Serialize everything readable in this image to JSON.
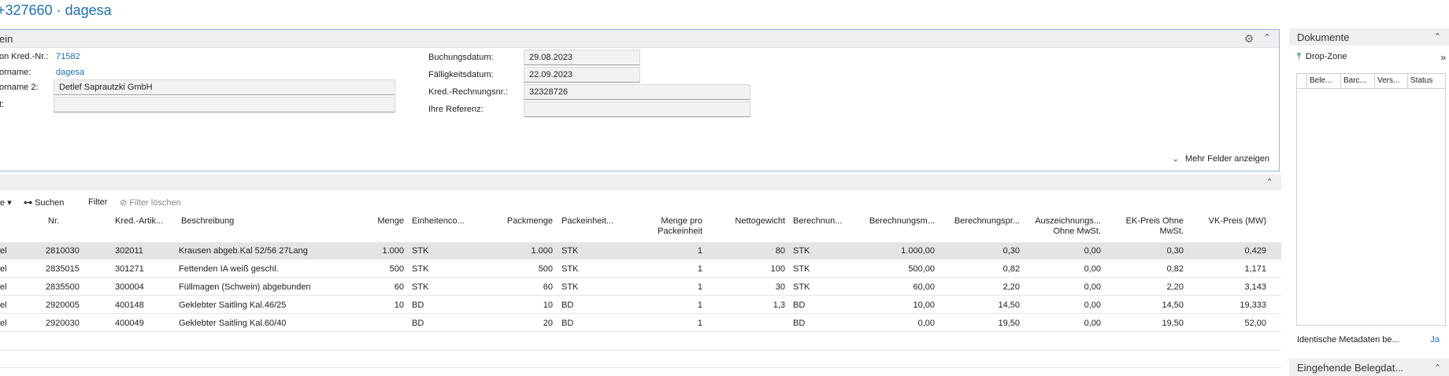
{
  "page": {
    "title": "+327660 · dagesa"
  },
  "general": {
    "caption": "ein",
    "fields": {
      "vendor_no_label": "on Kred.-Nr.:",
      "vendor_no": "71582",
      "vendor_name_label": "orname:",
      "vendor_name": "dagesa",
      "vendor_name2_label": "orname 2:",
      "vendor_name2": "Detlef Saprautzki GmbH",
      "contact_label": "t:",
      "contact": "",
      "posting_date_label": "Buchungsdatum:",
      "posting_date": "29.08.2023",
      "due_date_label": "Fälligkeitsdatum:",
      "due_date": "22.09.2023",
      "vendor_invoice_no_label": "Kred.-Rechnungsnr.:",
      "vendor_invoice_no": "32328726",
      "your_reference_label": "Ihre Referenz:",
      "your_reference": ""
    },
    "more_fields": "Mehr Felder anzeigen"
  },
  "lines": {
    "actions": {
      "partial": "e",
      "search": "Suchen",
      "filter": "Filter",
      "clear_filter": "Filter löschen"
    },
    "headers": {
      "type": "",
      "no": "Nr.",
      "vendor_item": "Kred.-Artik...",
      "description": "Beschreibung",
      "quantity": "Menge",
      "unit_code": "Einheitenco...",
      "pack_qty": "Packmenge",
      "pack_unit": "Packeinheit...",
      "qty_per_pack_1": "Menge pro",
      "qty_per_pack_2": "Packeinheit",
      "net_weight": "Nettogewicht",
      "calc_unit": "Berechnun...",
      "calc_qty": "Berechnungsm...",
      "calc_price": "Berechnungspr...",
      "marking_1": "Auszeichnungs...",
      "marking_2": "Ohne MwSt.",
      "purchase_price_1": "EK-Preis Ohne",
      "purchase_price_2": "MwSt.",
      "sales_price": "VK-Preis (MW)"
    },
    "rows": [
      {
        "type": "el",
        "no": "2810030",
        "vendor_item": "302011",
        "description": "Krausen abgeb.Kal 52/56 27Lang",
        "quantity": "1.000",
        "unit": "STK",
        "pack_qty": "1.000",
        "pack_unit": "STK",
        "qty_per_pack": "1",
        "net_weight": "80",
        "calc_unit": "STK",
        "calc_qty": "1.000,00",
        "calc_price": "0,30",
        "marking": "0,00",
        "purchase_price": "0,30",
        "sales_price": "0,429"
      },
      {
        "type": "el",
        "no": "2835015",
        "vendor_item": "301271",
        "description": "Fettenden IA weiß geschl.",
        "quantity": "500",
        "unit": "STK",
        "pack_qty": "500",
        "pack_unit": "STK",
        "qty_per_pack": "1",
        "net_weight": "100",
        "calc_unit": "STK",
        "calc_qty": "500,00",
        "calc_price": "0,82",
        "marking": "0,00",
        "purchase_price": "0,82",
        "sales_price": "1,171"
      },
      {
        "type": "el",
        "no": "2835500",
        "vendor_item": "300004",
        "description": "Füllmagen (Schwein) abgebunden",
        "quantity": "60",
        "unit": "STK",
        "pack_qty": "60",
        "pack_unit": "STK",
        "qty_per_pack": "1",
        "net_weight": "30",
        "calc_unit": "STK",
        "calc_qty": "60,00",
        "calc_price": "2,20",
        "marking": "0,00",
        "purchase_price": "2,20",
        "sales_price": "3,143"
      },
      {
        "type": "el",
        "no": "2920005",
        "vendor_item": "400148",
        "description": "Geklebter Saitling Kal.46/25",
        "quantity": "10",
        "unit": "BD",
        "pack_qty": "10",
        "pack_unit": "BD",
        "qty_per_pack": "1",
        "net_weight": "1,3",
        "calc_unit": "BD",
        "calc_qty": "10,00",
        "calc_price": "14,50",
        "marking": "0,00",
        "purchase_price": "14,50",
        "sales_price": "19,333"
      },
      {
        "type": "el",
        "no": "2920030",
        "vendor_item": "400049",
        "description": "Geklebter Saitling Kal.60/40",
        "quantity": "",
        "unit": "BD",
        "pack_qty": "20",
        "pack_unit": "BD",
        "qty_per_pack": "1",
        "net_weight": "",
        "calc_unit": "BD",
        "calc_qty": "0,00",
        "calc_price": "19,50",
        "marking": "0,00",
        "purchase_price": "19,50",
        "sales_price": "52,00"
      }
    ]
  },
  "documents": {
    "title": "Dokumente",
    "drop_zone": "Drop-Zone",
    "columns": [
      "Bele...",
      "Barc...",
      "Vers...",
      "Status"
    ],
    "identical_metadata_label": "Identische Metadaten be...",
    "identical_metadata_value": "Ja"
  },
  "incoming": {
    "title": "Eingehende Belegdat..."
  }
}
